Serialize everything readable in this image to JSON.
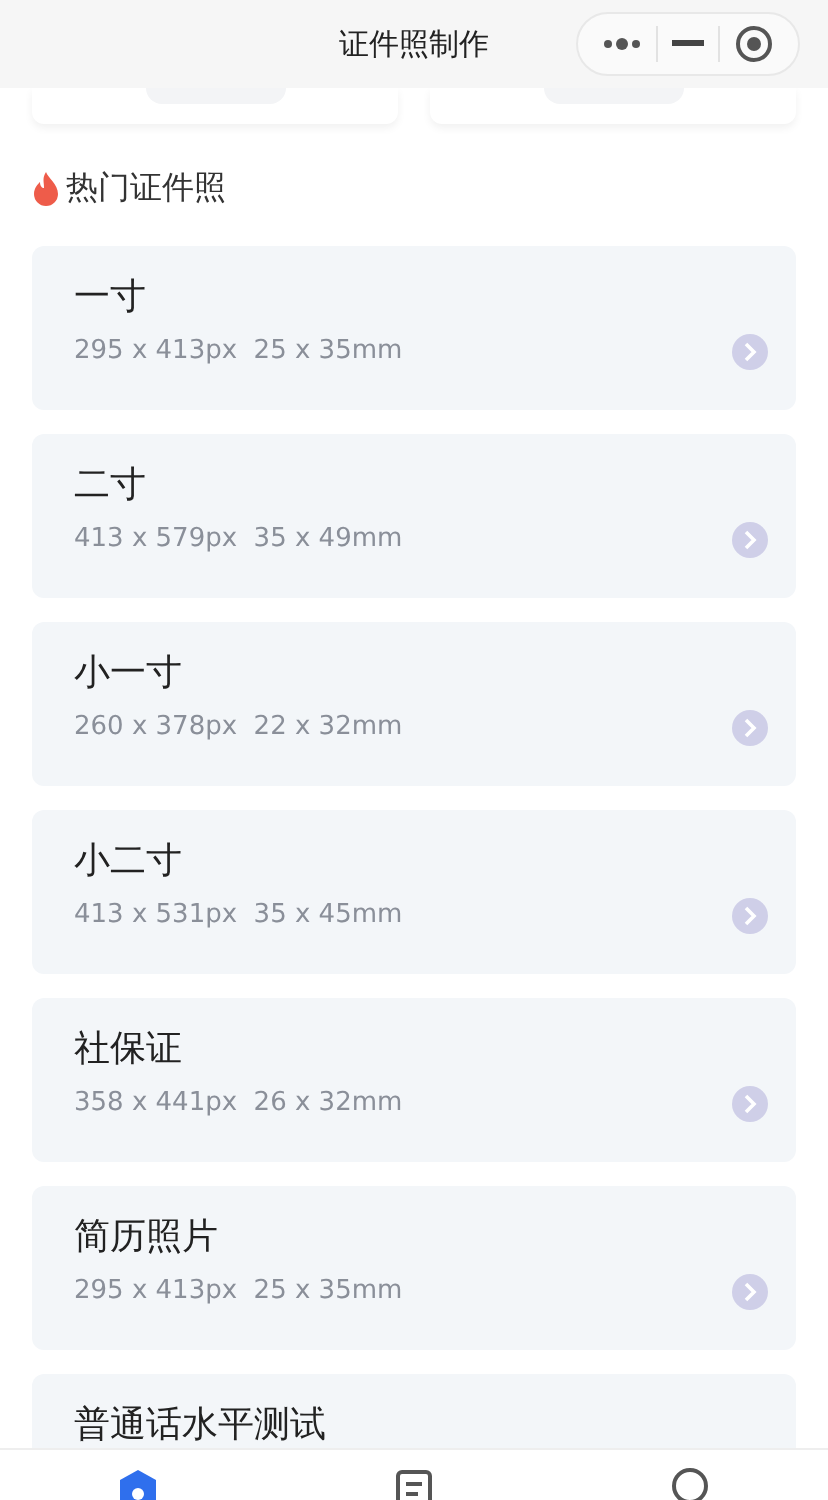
{
  "header": {
    "title": "证件照制作"
  },
  "section": {
    "title": "热门证件照"
  },
  "items": [
    {
      "name": "一寸",
      "spec": "295 x 413px  25 x 35mm"
    },
    {
      "name": "二寸",
      "spec": "413 x 579px  35 x 49mm"
    },
    {
      "name": "小一寸",
      "spec": "260 x 378px  22 x 32mm"
    },
    {
      "name": "小二寸",
      "spec": "413 x 531px  35 x 45mm"
    },
    {
      "name": "社保证",
      "spec": "358 x 441px  26 x 32mm"
    },
    {
      "name": "简历照片",
      "spec": "295 x 413px  25 x 35mm"
    },
    {
      "name": "普通话水平测试"
    }
  ],
  "tabbar": [
    {
      "kind": "home",
      "selected": true
    },
    {
      "kind": "list",
      "selected": false
    },
    {
      "kind": "profile",
      "selected": false
    }
  ]
}
